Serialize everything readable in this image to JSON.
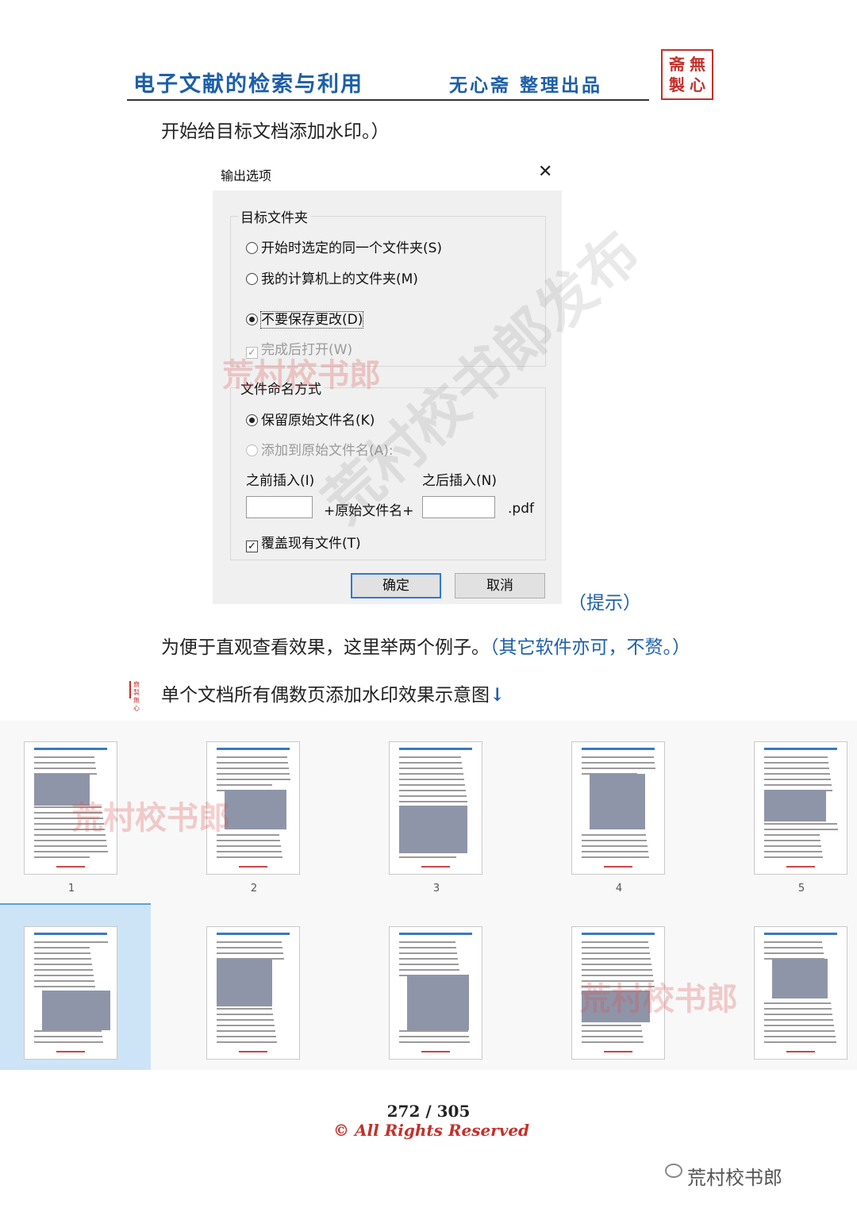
{
  "header": {
    "title": "电子文献的检索与利用",
    "subtitle": "无心斋 整理出品",
    "seal_chars": [
      "斋",
      "無",
      "製",
      "心"
    ]
  },
  "text": {
    "para1": "开始给目标文档添加水印。）",
    "hint": "（提示）",
    "para2": "为便于直观查看效果，这里举两个例子。",
    "para2_note": "（其它软件亦可，不赘。）",
    "caption": "单个文档所有偶数页添加水印效果示意图",
    "caption_arrow": "↓",
    "caption_mark": "齋製 無心"
  },
  "dialog": {
    "title": "输出选项",
    "close": "✕",
    "target_folder": {
      "legend": "目标文件夹",
      "opt_same": "开始时选定的同一个文件夹(S)",
      "opt_my_computer": "我的计算机上的文件夹(M)",
      "opt_dont_save": "不要保存更改(D)",
      "open_after": "完成后打开(W)"
    },
    "naming": {
      "legend": "文件命名方式",
      "opt_keep": "保留原始文件名(K)",
      "opt_add": "添加到原始文件名(A):",
      "insert_before": "之前插入(I)",
      "insert_after": "之后插入(N)",
      "original_name": "+原始文件名+",
      "ext": ".pdf",
      "overwrite": "覆盖现有文件(T)"
    },
    "ok": "确定",
    "cancel": "取消"
  },
  "watermarks": {
    "text1": "荒村校书郎",
    "text2": "荒村校书郎",
    "text3": "荒村校书郎",
    "diagonal": "荒村校书郎发布"
  },
  "thumbnails": {
    "labels": [
      "1",
      "2",
      "3",
      "4",
      "5"
    ],
    "selected_index": 5
  },
  "footer": {
    "page": "272",
    "sep": "/",
    "total": "305",
    "rights": "© All Rights Reserved",
    "wechat": "荒村校书郎"
  },
  "colors": {
    "header_blue": "#1d5fa8",
    "seal_red": "#c4302b",
    "selection": "#cde4f7"
  }
}
